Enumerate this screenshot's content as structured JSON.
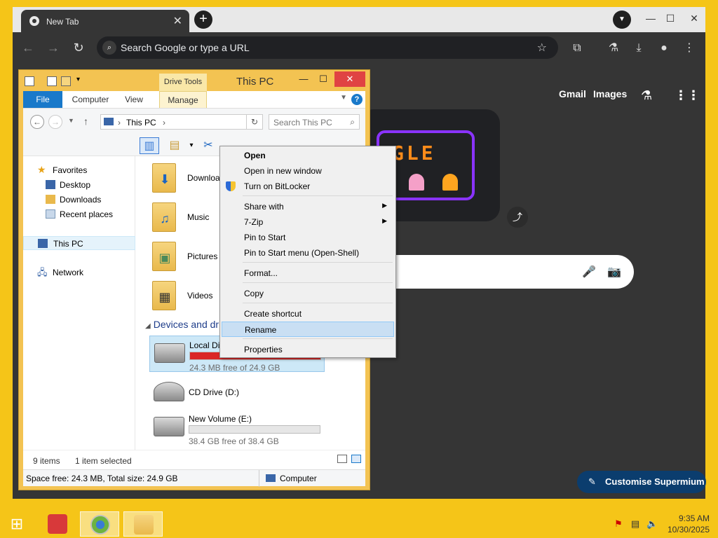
{
  "chrome": {
    "tab_title": "New Tab",
    "tab_close": "✕",
    "new_tab": "+",
    "omnibox_placeholder": "Search Google or type a URL",
    "ntp_links": [
      "Gmail",
      "Images"
    ],
    "doodle_text": "GLE",
    "customise_label": "Customise Supermium"
  },
  "explorer": {
    "title": "This PC",
    "drive_tools": "Drive Tools",
    "ribbon_tabs": [
      "File",
      "Computer",
      "View",
      "Manage"
    ],
    "address": "This PC",
    "search_placeholder": "Search This PC",
    "nav": {
      "favorites": "Favorites",
      "desktop": "Desktop",
      "downloads": "Downloads",
      "recent": "Recent places",
      "this_pc": "This PC",
      "network": "Network"
    },
    "folders": [
      "Downloads",
      "Music",
      "Pictures",
      "Videos"
    ],
    "devices_header": "Devices and drives",
    "drives": [
      {
        "label": "Local Disk (C:)",
        "free": "24.3 MB free of 24.9 GB",
        "used_fraction": 0.999,
        "bar_color": "#da2626"
      },
      {
        "label": "CD Drive (D:)"
      },
      {
        "label": "New Volume (E:)",
        "free": "38.4 GB free of 38.4 GB",
        "used_fraction": 0.0,
        "bar_color": "#26a0da"
      }
    ],
    "status": {
      "items": "9 items",
      "selected": "1 item selected"
    },
    "details": {
      "space": "Space free: 24.3 MB, Total size: 24.9 GB",
      "location": "Computer"
    }
  },
  "context_menu": {
    "items": [
      {
        "label": "Open",
        "bold": true
      },
      {
        "label": "Open in new window"
      },
      {
        "label": "Turn on BitLocker",
        "icon": "shield-icon"
      },
      {
        "label": "Share with",
        "submenu": true
      },
      {
        "label": "7-Zip",
        "submenu": true
      },
      {
        "label": "Pin to Start"
      },
      {
        "label": "Pin to Start menu (Open-Shell)"
      },
      {
        "label": "Format..."
      },
      {
        "label": "Copy"
      },
      {
        "label": "Create shortcut"
      },
      {
        "label": "Rename",
        "highlighted": true
      },
      {
        "label": "Properties"
      }
    ]
  },
  "taskbar": {
    "time": "9:35 AM",
    "date": "10/30/2025"
  },
  "colors": {
    "desktop": "#f5c518",
    "chrome_bg": "#353535",
    "accent": "#1979ca",
    "menu_highlight": "#c9dff3"
  }
}
